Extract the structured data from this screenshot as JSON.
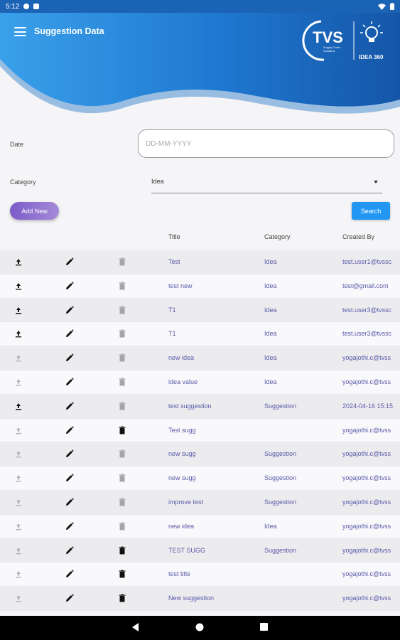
{
  "status": {
    "time": "5:12"
  },
  "header": {
    "title": "Suggestion Data",
    "logo_main": "TVS",
    "logo_sub": "Supply Chain Solutions",
    "logo_product": "IDEA 360"
  },
  "form": {
    "date_label": "Date",
    "date_placeholder": "DD-MM-YYYY",
    "category_label": "Category",
    "category_value": "Idea",
    "add_button": "Add New",
    "search_button": "Search"
  },
  "table": {
    "columns": [
      "Title",
      "Category",
      "Created By"
    ],
    "rows": [
      {
        "title": "Test",
        "category": "Idea",
        "created_by": "test.user1@tvssc",
        "upload": "active",
        "delete": "disabled"
      },
      {
        "title": "test new",
        "category": "Idea",
        "created_by": "test@gmail.com",
        "upload": "active",
        "delete": "disabled"
      },
      {
        "title": "T1",
        "category": "Idea",
        "created_by": "test.user3@tvssc",
        "upload": "active",
        "delete": "disabled"
      },
      {
        "title": "T1",
        "category": "Idea",
        "created_by": "test.user3@tvssc",
        "upload": "active",
        "delete": "disabled"
      },
      {
        "title": "new idea",
        "category": "Idea",
        "created_by": "yogajothi.c@tvss",
        "upload": "disabled",
        "delete": "disabled"
      },
      {
        "title": "idea value",
        "category": "Idea",
        "created_by": "yogajothi.c@tvss",
        "upload": "disabled",
        "delete": "disabled"
      },
      {
        "title": "test suggestion",
        "category": "Suggestion",
        "created_by": "2024-04-16 15:15",
        "upload": "active",
        "delete": "disabled"
      },
      {
        "title": "Test sugg",
        "category": "",
        "created_by": "yogajothi.c@tvss",
        "upload": "disabled",
        "delete": "active"
      },
      {
        "title": "new sugg",
        "category": "Suggestion",
        "created_by": "yogajothi.c@tvss",
        "upload": "disabled",
        "delete": "disabled"
      },
      {
        "title": "new sugg",
        "category": "Suggestion",
        "created_by": "yogajothi.c@tvss",
        "upload": "disabled",
        "delete": "disabled"
      },
      {
        "title": "improve test",
        "category": "Suggestion",
        "created_by": "yogajothi.c@tvss",
        "upload": "disabled",
        "delete": "disabled"
      },
      {
        "title": "new idea",
        "category": "Idea",
        "created_by": "yogajothi.c@tvss",
        "upload": "disabled",
        "delete": "disabled"
      },
      {
        "title": "TEST SUGG",
        "category": "Suggestion",
        "created_by": "yogajothi.c@tvss",
        "upload": "disabled",
        "delete": "active"
      },
      {
        "title": "test title",
        "category": "",
        "created_by": "yogajothi.c@tvss",
        "upload": "disabled",
        "delete": "active"
      },
      {
        "title": "New suggestion",
        "category": "",
        "created_by": "yogajothi.c@tvss",
        "upload": "disabled",
        "delete": "active"
      }
    ]
  },
  "colors": {
    "header_blue": "#1b63b5",
    "accent_blue": "#2196f3",
    "link_text": "#5b58a8",
    "add_button": "#8a6bd0"
  }
}
